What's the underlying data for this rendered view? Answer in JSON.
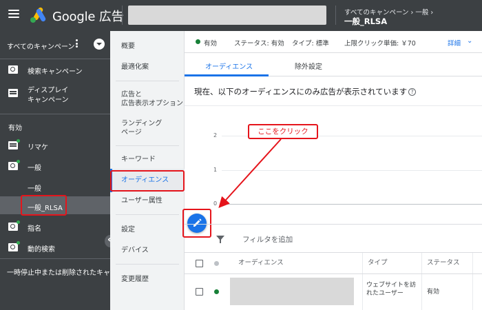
{
  "topbar": {
    "brand": "Google 広告",
    "breadcrumb_parent": "すべてのキャンペーン › 一般 ›",
    "breadcrumb_current": "一般_RLSA"
  },
  "leftnav": {
    "header": "すべてのキャンペーン",
    "items": [
      {
        "label": "検索キャンペーン"
      },
      {
        "label": "ディスプレイ\nキャンペーン"
      }
    ],
    "section_label": "有効",
    "campaigns": [
      {
        "label": "リマケ"
      },
      {
        "label": "一般"
      },
      {
        "label": "一般"
      },
      {
        "label": "一般_RLSA"
      },
      {
        "label": "指名"
      },
      {
        "label": "動的検索"
      }
    ],
    "footer": "一時停止中または削除されたキャン"
  },
  "midnav": {
    "items": [
      {
        "label": "概要"
      },
      {
        "label": "最適化案"
      },
      {
        "label": "広告と\n広告表示オプション"
      },
      {
        "label": "ランディング\nページ"
      },
      {
        "label": "キーワード"
      },
      {
        "label": "オーディエンス"
      },
      {
        "label": "ユーザー属性"
      },
      {
        "label": "設定"
      },
      {
        "label": "デバイス"
      },
      {
        "label": "変更履歴"
      }
    ]
  },
  "status": {
    "state": "有効",
    "status_text": "ステータス: 有効",
    "type_text": "タイプ: 標準",
    "cpc_text": "上限クリック単価: ￥70",
    "details": "詳細"
  },
  "tabs": [
    {
      "label": "オーディエンス"
    },
    {
      "label": "除外設定"
    }
  ],
  "description": "現在、以下のオーディエンスにのみ広告が表示されています",
  "chart": {
    "ticks": [
      "2",
      "1",
      "0"
    ]
  },
  "callout": "ここをクリック",
  "filter": {
    "label": "フィルタを追加"
  },
  "table": {
    "headers": [
      "オーディエンス",
      "タイプ",
      "ステータス"
    ],
    "rows": [
      {
        "type": "ウェブサイトを訪\nれたユーザー",
        "status": "有効"
      }
    ]
  },
  "colors": {
    "accent": "#1a73e8",
    "annotation": "#e5141b",
    "active_green": "#188038"
  }
}
